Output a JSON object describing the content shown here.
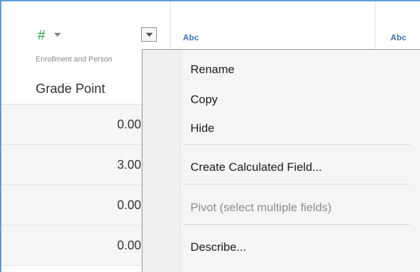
{
  "column": {
    "type_icon": "hash-icon",
    "source_label": "Enrollment and Person",
    "field_name": "Grade Point",
    "menu_button_icon": "chevron-down-icon"
  },
  "other_columns": [
    {
      "type_label": "Abc"
    },
    {
      "type_label": "Abc"
    }
  ],
  "rows": [
    {
      "value": "0.00"
    },
    {
      "value": "3.00"
    },
    {
      "value": "0.00"
    },
    {
      "value": "0.00"
    }
  ],
  "context_menu": {
    "items": [
      {
        "label": "Rename",
        "enabled": true
      },
      {
        "label": "Copy",
        "enabled": true
      },
      {
        "label": "Hide",
        "enabled": true
      },
      {
        "label": "Create Calculated Field...",
        "enabled": true
      },
      {
        "label": "Pivot (select multiple fields)",
        "enabled": false
      },
      {
        "label": "Describe...",
        "enabled": true
      }
    ]
  },
  "colors": {
    "number_type": "#2e9e3c",
    "string_type": "#3b6fb3",
    "frame_border": "#5b9bd5"
  }
}
